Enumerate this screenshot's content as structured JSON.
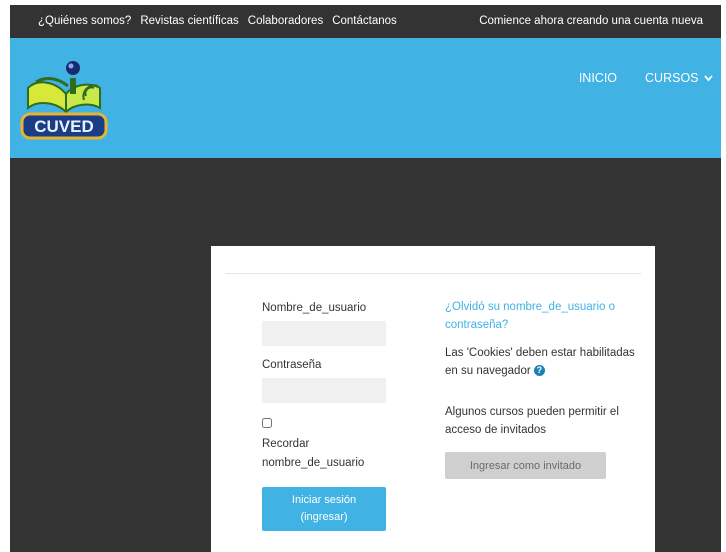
{
  "topbar": {
    "links": [
      "¿Quiénes somos?",
      "Revistas científicas",
      "Colaboradores",
      "Contáctanos"
    ],
    "signup_link": "Comience ahora creando una cuenta nueva"
  },
  "header": {
    "logo_text": "CUVED",
    "nav": {
      "home": "INICIO",
      "courses": "CURSOS"
    },
    "accent_color": "#41b2e4"
  },
  "login": {
    "username_label": "Nombre_de_usuario",
    "username_value": "",
    "password_label": "Contraseña",
    "password_value": "",
    "remember_label": "Recordar nombre_de_usuario",
    "login_button": "Iniciar sesión (ingresar)",
    "forgot_link": "¿Olvidó su nombre_de_usuario o contraseña?",
    "cookies_notice": "Las 'Cookies' deben estar habilitadas en su navegador",
    "help_icon": "question-circle-icon",
    "guest_notice": "Algunos cursos pueden permitir el acceso de invitados",
    "guest_button": "Ingresar como invitado"
  }
}
